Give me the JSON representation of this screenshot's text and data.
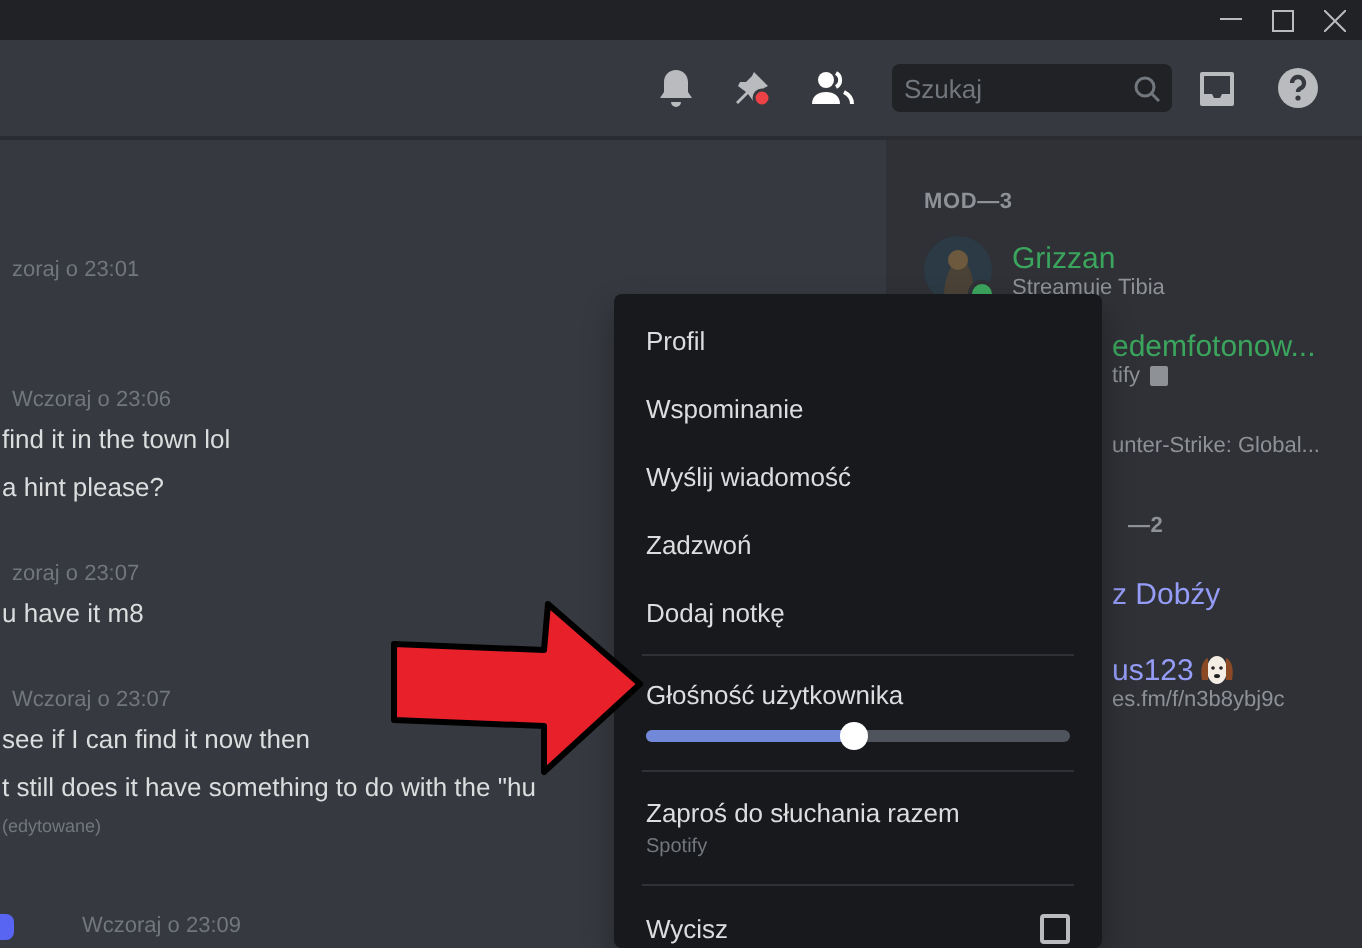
{
  "header": {
    "search": {
      "placeholder": "Szukaj"
    }
  },
  "messages": [
    {
      "kind": "timestamp",
      "text": "zoraj o 23:01"
    },
    {
      "kind": "gap"
    },
    {
      "kind": "timestamp",
      "text": "Wczoraj o 23:06"
    },
    {
      "kind": "text",
      "text": "find it in the town lol"
    },
    {
      "kind": "text",
      "text": "a hint please?"
    },
    {
      "kind": "gap"
    },
    {
      "kind": "timestamp",
      "text": "zoraj o 23:07"
    },
    {
      "kind": "text",
      "text": "u have it m8"
    },
    {
      "kind": "gap"
    },
    {
      "kind": "timestamp",
      "text": "Wczoraj o 23:07"
    },
    {
      "kind": "text",
      "text": "see if I can find it now then"
    },
    {
      "kind": "text",
      "text": "t still does it have something to do with the \"hu"
    },
    {
      "kind": "edited",
      "text": "(edytowane)"
    },
    {
      "kind": "gap"
    },
    {
      "kind": "author",
      "text": "Wczoraj o 23:09"
    }
  ],
  "members": [
    {
      "title": "MOD—3",
      "items": [
        {
          "name": "Grizzan",
          "color": "#3ba55d",
          "activity": "Streamuje Tibia",
          "avatar": true,
          "online": true
        },
        {
          "name": "edemfotonow...",
          "color": "#3ba55d",
          "activity": "tify",
          "details": true
        },
        {
          "activity": "unter-Strike: Global..."
        }
      ]
    },
    {
      "title": "—2",
      "items": [
        {
          "name": "z Dobźy",
          "color": "#949cf7"
        },
        {
          "name": "us123",
          "color": "#949cf7",
          "emoji": true,
          "activity": "es.fm/f/n3b8ybj9c"
        }
      ]
    }
  ],
  "menu": [
    {
      "kind": "item",
      "label": "Profil"
    },
    {
      "kind": "item",
      "label": "Wspominanie"
    },
    {
      "kind": "item",
      "label": "Wyślij wiadomość"
    },
    {
      "kind": "item",
      "label": "Zadzwoń"
    },
    {
      "kind": "item",
      "label": "Dodaj notkę"
    },
    {
      "kind": "divider"
    },
    {
      "kind": "slider",
      "label": "Głośność użytkownika",
      "level": 0.49
    },
    {
      "kind": "divider"
    },
    {
      "kind": "item",
      "label": "Zaproś do słuchania razem",
      "sublabel": "Spotify"
    },
    {
      "kind": "divider"
    },
    {
      "kind": "checkbox",
      "label": "Wycisz",
      "checked": false
    }
  ]
}
